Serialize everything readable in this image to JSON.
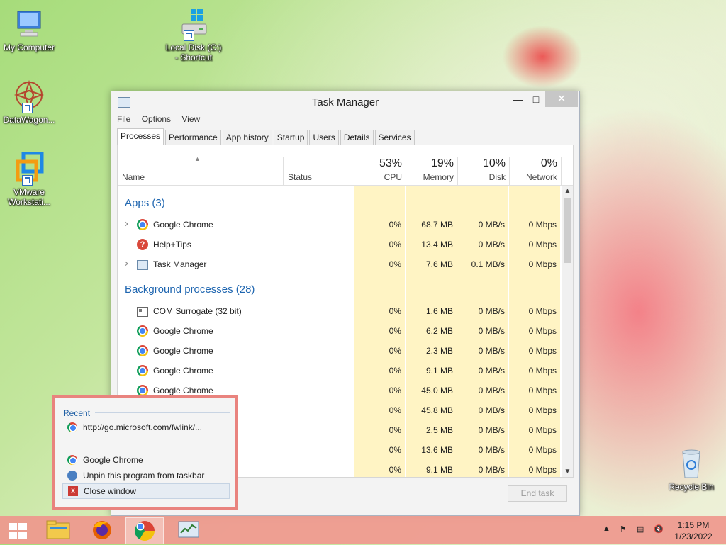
{
  "desktop": {
    "icons": [
      {
        "label": "My Computer"
      },
      {
        "label": "Local Disk (C:) - Shortcut"
      },
      {
        "label": "DataWagon..."
      },
      {
        "label": "VMware Workstati..."
      },
      {
        "label": "Recycle Bin"
      }
    ]
  },
  "window": {
    "title": "Task Manager",
    "controls": {
      "minimize": "—",
      "maximize": "□",
      "close": "✕"
    },
    "menu": [
      "File",
      "Options",
      "View"
    ],
    "tabs": [
      "Processes",
      "Performance",
      "App history",
      "Startup",
      "Users",
      "Details",
      "Services"
    ],
    "active_tab": "Processes",
    "columns": {
      "name": "Name",
      "status": "Status",
      "cpu": {
        "pct": "53%",
        "label": "CPU"
      },
      "memory": {
        "pct": "19%",
        "label": "Memory"
      },
      "disk": {
        "pct": "10%",
        "label": "Disk"
      },
      "network": {
        "pct": "0%",
        "label": "Network"
      }
    },
    "groups": {
      "apps": "Apps (3)",
      "background": "Background processes (28)"
    },
    "apps": [
      {
        "name": "Google Chrome",
        "icon": "chrome-icon",
        "expandable": true,
        "cpu": "0%",
        "memory": "68.7 MB",
        "disk": "0 MB/s",
        "network": "0 Mbps"
      },
      {
        "name": "Help+Tips",
        "icon": "help-icon",
        "expandable": false,
        "cpu": "0%",
        "memory": "13.4 MB",
        "disk": "0 MB/s",
        "network": "0 Mbps"
      },
      {
        "name": "Task Manager",
        "icon": "task-manager-icon",
        "expandable": true,
        "cpu": "0%",
        "memory": "7.6 MB",
        "disk": "0.1 MB/s",
        "network": "0 Mbps"
      }
    ],
    "background": [
      {
        "name": "COM Surrogate (32 bit)",
        "icon": "com-surrogate-icon",
        "cpu": "0%",
        "memory": "1.6 MB",
        "disk": "0 MB/s",
        "network": "0 Mbps"
      },
      {
        "name": "Google Chrome",
        "icon": "chrome-icon",
        "cpu": "0%",
        "memory": "6.2 MB",
        "disk": "0 MB/s",
        "network": "0 Mbps"
      },
      {
        "name": "Google Chrome",
        "icon": "chrome-icon",
        "cpu": "0%",
        "memory": "2.3 MB",
        "disk": "0 MB/s",
        "network": "0 Mbps"
      },
      {
        "name": "Google Chrome",
        "icon": "chrome-icon",
        "cpu": "0%",
        "memory": "9.1 MB",
        "disk": "0 MB/s",
        "network": "0 Mbps"
      },
      {
        "name": "Google Chrome",
        "icon": "chrome-icon",
        "cpu": "0%",
        "memory": "45.0 MB",
        "disk": "0 MB/s",
        "network": "0 Mbps"
      },
      {
        "name": "",
        "icon": "",
        "cpu": "0%",
        "memory": "45.8 MB",
        "disk": "0 MB/s",
        "network": "0 Mbps"
      },
      {
        "name": "",
        "icon": "",
        "cpu": "0%",
        "memory": "2.5 MB",
        "disk": "0 MB/s",
        "network": "0 Mbps"
      },
      {
        "name": "",
        "icon": "",
        "cpu": "0%",
        "memory": "13.6 MB",
        "disk": "0 MB/s",
        "network": "0 Mbps"
      },
      {
        "name": "",
        "icon": "",
        "cpu": "0%",
        "memory": "9.1 MB",
        "disk": "0 MB/s",
        "network": "0 Mbps"
      }
    ],
    "end_task": "End task"
  },
  "jumplist": {
    "section": "Recent",
    "recent": "http://go.microsoft.com/fwlink/...",
    "items": {
      "open": "Google Chrome",
      "unpin": "Unpin this program from taskbar",
      "close": "Close window"
    }
  },
  "taskbar": {
    "items": [
      "start-button",
      "file-explorer-icon",
      "firefox-icon",
      "chrome-icon",
      "task-manager-icon"
    ],
    "active": "chrome-icon",
    "tray_icons": [
      "show-hidden-icons",
      "action-center-flag-icon",
      "network-icon",
      "volume-muted-icon"
    ],
    "time": "1:15 PM",
    "date": "1/23/2022"
  },
  "colors": {
    "accent_blue": "#1f66b0",
    "column_highlight": "#fff4c4",
    "jumplist_border": "#e9837e",
    "taskbar": "#ee968c"
  }
}
